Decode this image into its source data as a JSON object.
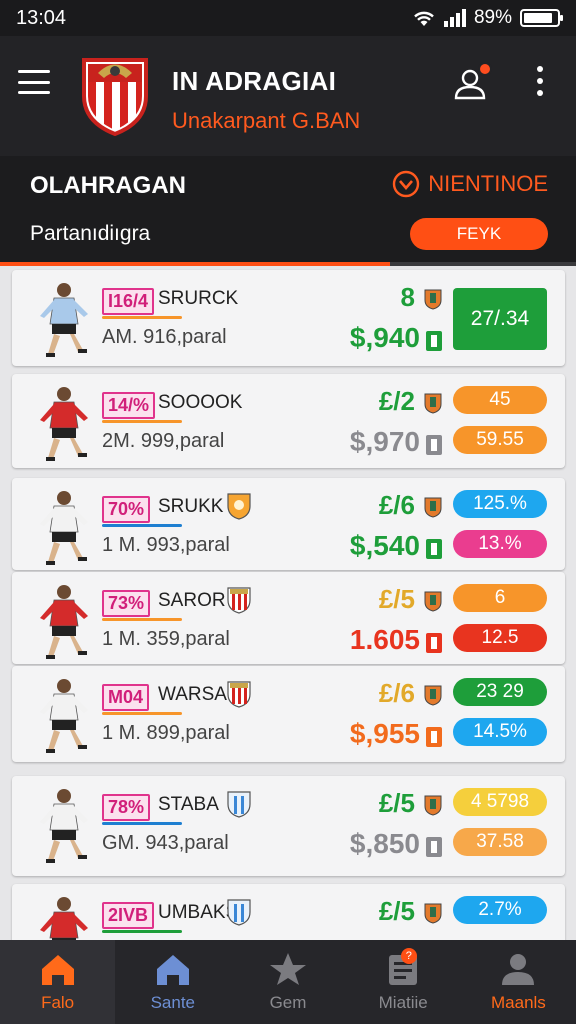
{
  "status_bar": {
    "time": "13:04",
    "battery": "89%",
    "battery_level": 0.89
  },
  "header": {
    "title": "IN ADRAGIAI",
    "subtitle": "Unakarpant G.BAN",
    "icons": [
      "menu-icon",
      "club-crest",
      "profile-icon",
      "more-vertical-icon"
    ]
  },
  "section": {
    "title": "OLAHRAGAN",
    "action_label": "NIENTINOE",
    "subtitle": "Partanıdiıgra",
    "filter_label": "FEYK"
  },
  "colors": {
    "accent": "#ff4f14",
    "green": "#1e9e3a",
    "orange": "#f7952a",
    "red": "#e8341f",
    "blue": "#1ea7ef",
    "pink": "#ea3d8f",
    "yellow": "#f5cf3c",
    "gray": "#8a8a8f"
  },
  "players": [
    {
      "tag": "I16/4",
      "name": "SRURCK",
      "sub": "AM. 916,paral",
      "rating": "8",
      "price": "$,940",
      "pill_top": "27/.34",
      "pill_bottom": "",
      "rating_color": "#1e9e3a",
      "price_color": "#1e9e3a",
      "underline_color": "#f7952a",
      "pill_top_color": "#1e9e3a",
      "pill_bottom_color": "",
      "jersey": "#a9c9ea",
      "badge": ""
    },
    {
      "tag": "14/%",
      "name": "SOOOOK",
      "sub": "2M. 999,paral",
      "rating": "£/2",
      "price": "$,970",
      "pill_top": "45",
      "pill_bottom": "59.55",
      "rating_color": "#1e9e3a",
      "price_color": "#8a8a8f",
      "underline_color": "#f7952a",
      "pill_top_color": "#f7952a",
      "pill_bottom_color": "#f7952a",
      "jersey": "#d42b2b",
      "badge": ""
    },
    {
      "tag": "70%",
      "name": "SRUKK",
      "sub": "1 M. 993,paral",
      "rating": "£/6",
      "price": "$,540",
      "pill_top": "125.%",
      "pill_bottom": "13.%",
      "rating_color": "#1e9e3a",
      "price_color": "#1e9e3a",
      "underline_color": "#1e7fd1",
      "pill_top_color": "#1ea7ef",
      "pill_bottom_color": "#ea3d8f",
      "jersey": "#f2f2f2",
      "badge": "orange-crest"
    },
    {
      "tag": "73%",
      "name": "SAROR",
      "sub": "1 M. 359,paral",
      "rating": "£/5",
      "price": "1.605",
      "pill_top": "6",
      "pill_bottom": "12.5",
      "rating_color": "#e2a92a",
      "price_color": "#e8341f",
      "underline_color": "#f7952a",
      "pill_top_color": "#f7952a",
      "pill_bottom_color": "#e8341f",
      "jersey": "#d42b2b",
      "badge": "striped-crest"
    },
    {
      "tag": "M04",
      "name": "WARSA",
      "sub": "1 M. 899,paral",
      "rating": "£/6",
      "price": "$,955",
      "pill_top": "23 29",
      "pill_bottom": "14.5%",
      "rating_color": "#e2a92a",
      "price_color": "#f26b1d",
      "underline_color": "#f7952a",
      "pill_top_color": "#1e9e3a",
      "pill_bottom_color": "#1ea7ef",
      "jersey": "#f2f2f2",
      "badge": "striped-crest"
    },
    {
      "tag": "78%",
      "name": "STABA",
      "sub": "GM. 943,paral",
      "rating": "£/5",
      "price": "$,850",
      "pill_top": "4 5798",
      "pill_bottom": "37.58",
      "rating_color": "#1e9e3a",
      "price_color": "#8a8a8f",
      "underline_color": "#1e7fd1",
      "pill_top_color": "#f5cf3c",
      "pill_bottom_color": "#f7a84a",
      "jersey": "#f2f2f2",
      "badge": "blue-crest"
    },
    {
      "tag": "2IVB",
      "name": "UMBAKS",
      "sub": "",
      "rating": "£/5",
      "price": "",
      "pill_top": "2.7%",
      "pill_bottom": "",
      "rating_color": "#1e9e3a",
      "price_color": "#1e9e3a",
      "underline_color": "#1e9e3a",
      "pill_top_color": "#1ea7ef",
      "pill_bottom_color": "",
      "jersey": "#d42b2b",
      "badge": "blue-crest"
    }
  ],
  "bottom_nav": [
    {
      "label": "Falo",
      "icon": "home-icon",
      "active": true
    },
    {
      "label": "Sante",
      "icon": "home-alt-icon",
      "active": false
    },
    {
      "label": "Gem",
      "icon": "star-icon",
      "active": false
    },
    {
      "label": "Miatiie",
      "icon": "news-icon",
      "active": false,
      "badge": "?"
    },
    {
      "label": "Maanls",
      "icon": "user-icon",
      "active": false
    }
  ]
}
